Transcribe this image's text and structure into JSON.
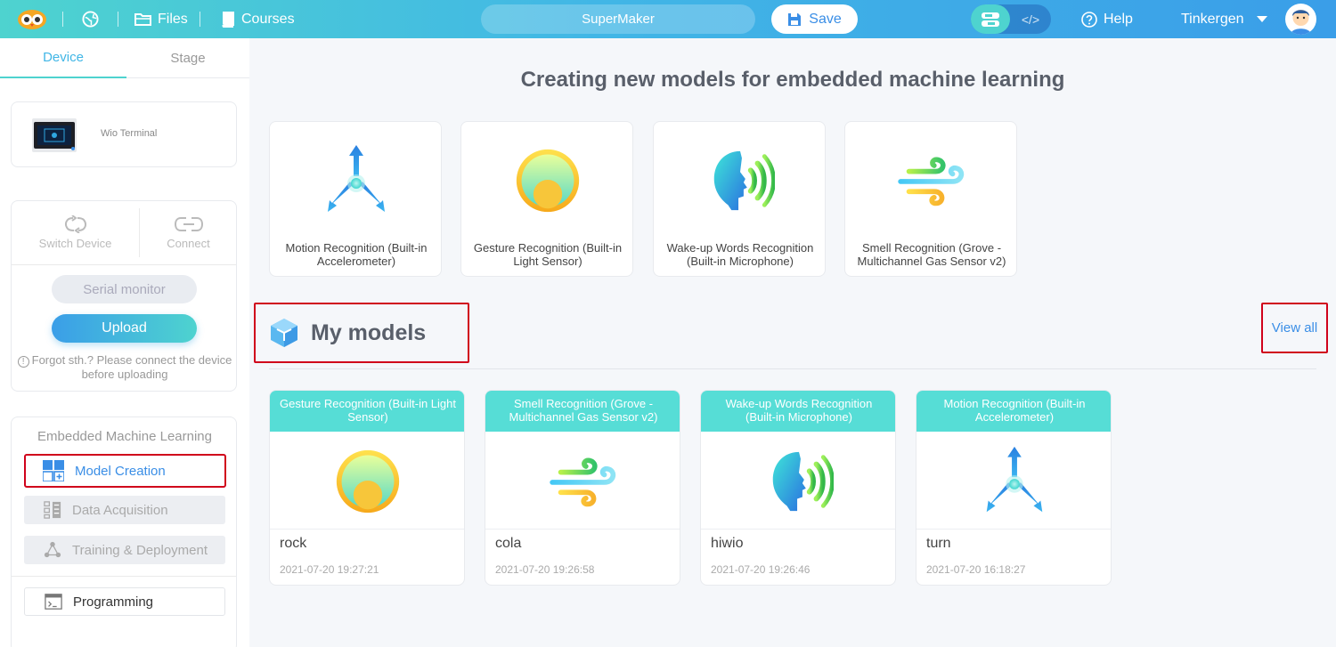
{
  "topbar": {
    "files_label": "Files",
    "courses_label": "Courses",
    "project_name": "SuperMaker",
    "save_label": "Save",
    "help_label": "Help",
    "user_name": "Tinkergen",
    "mode_code_icon": "</>"
  },
  "sidebar": {
    "tabs": [
      "Device",
      "Stage"
    ],
    "device_name": "Wio Terminal",
    "switch_device_label": "Switch Device",
    "connect_label": "Connect",
    "serial_monitor_label": "Serial monitor",
    "upload_label": "Upload",
    "hint_text": "Forgot sth.? Please connect the device before uploading",
    "eml_title": "Embedded Machine Learning",
    "eml_items": [
      "Model Creation",
      "Data Acquisition",
      "Training & Deployment"
    ],
    "programming_label": "Programming"
  },
  "main": {
    "title": "Creating new models for embedded machine learning",
    "templates": [
      {
        "label": "Motion Recognition (Built-in Accelerometer)",
        "icon": "motion-icon"
      },
      {
        "label": "Gesture Recognition (Built-in Light Sensor)",
        "icon": "light-sensor-icon"
      },
      {
        "label": "Wake-up Words Recognition (Built-in Microphone)",
        "icon": "voice-icon"
      },
      {
        "label": "Smell Recognition (Grove - Multichannel Gas Sensor v2)",
        "icon": "smell-icon"
      }
    ],
    "my_models_title": "My models",
    "view_all_label": "View all",
    "models": [
      {
        "type": "Gesture Recognition (Built-in Light Sensor)",
        "name": "rock",
        "date": "2021-07-20 19:27:21"
      },
      {
        "type": "Smell Recognition (Grove - Multichannel Gas Sensor v2)",
        "name": "cola",
        "date": "2021-07-20 19:26:58"
      },
      {
        "type": "Wake-up Words Recognition (Built-in Microphone)",
        "name": "hiwio",
        "date": "2021-07-20 19:26:46"
      },
      {
        "type": "Motion Recognition (Built-in Accelerometer)",
        "name": "turn",
        "date": "2021-07-20 16:18:27"
      }
    ]
  },
  "colors": {
    "accent": "#41b6e6",
    "teal": "#4ed3cf",
    "highlight": "#d0021b",
    "model_header": "#56ddd6"
  }
}
